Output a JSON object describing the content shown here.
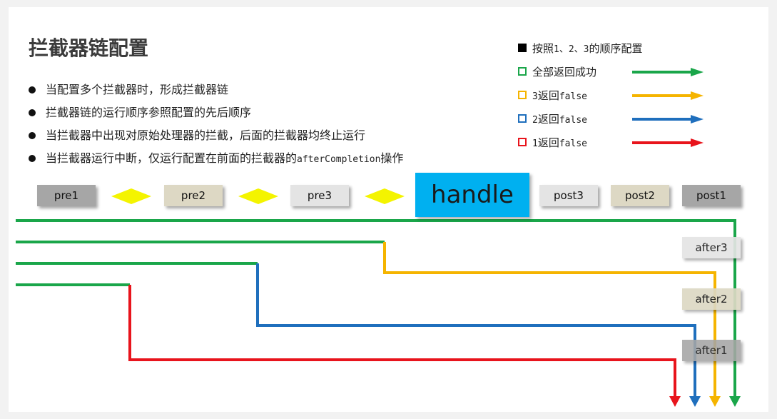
{
  "title": "拦截器链配置",
  "bullets": [
    "当配置多个拦截器时，形成拦截器链",
    "拦截器链的运行顺序参照配置的先后顺序",
    "当拦截器中出现对原始处理器的拦截，后面的拦截器均终止运行",
    {
      "pre": "当拦截器运行中断，仅运行配置在前面的拦截器的",
      "code": "afterCompletion",
      "post": "操作"
    }
  ],
  "legend": [
    {
      "text_a": "按照",
      "code": "1、2、3",
      "text_b": "的顺序配置",
      "color": "#000000",
      "filled": true,
      "arrow": false
    },
    {
      "text_a": "全部返回成功",
      "code": "",
      "text_b": "",
      "color": "#1aa64a",
      "filled": false,
      "arrow": true
    },
    {
      "text_a": "",
      "code": "3",
      "text_b": "返回",
      "code2": "false",
      "color": "#f5b400",
      "filled": false,
      "arrow": true
    },
    {
      "text_a": "",
      "code": "2",
      "text_b": "返回",
      "code2": "false",
      "color": "#1f6fbd",
      "filled": false,
      "arrow": true
    },
    {
      "text_a": "",
      "code": "1",
      "text_b": "返回",
      "code2": "false",
      "color": "#e8141c",
      "filled": false,
      "arrow": true
    }
  ],
  "flow": {
    "pre": [
      "pre1",
      "pre2",
      "pre3"
    ],
    "handle": "handle",
    "post": [
      "post3",
      "post2",
      "post1"
    ],
    "after": [
      "after3",
      "after2",
      "after1"
    ]
  },
  "colors": {
    "green": "#1aa64a",
    "yellow": "#f5b400",
    "blue": "#1f6fbd",
    "red": "#e8141c",
    "handle": "#00b0f0",
    "diamond": "#f4f400"
  }
}
